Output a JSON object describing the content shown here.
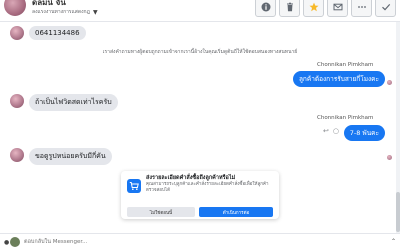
{
  "header": {
    "contact_name": "ดลมนี จัน",
    "status": "ลงแรงงานทางการแสดงกฎ",
    "toolbar": [
      {
        "icon": "info-icon"
      },
      {
        "icon": "trash-icon"
      },
      {
        "icon": "star-icon"
      },
      {
        "icon": "mail-icon"
      },
      {
        "icon": "more-icon"
      },
      {
        "icon": "check-icon"
      }
    ]
  },
  "messages": {
    "m1": "0641134486",
    "system_note": "เราส่งคำถามทางผู้ตอบถูกถามเข้าจากเรานี้อ้างในคุณเริ่มดูต้นถี่ให้ใช้ตอบสนองทางสนทนาย์",
    "sender1": "Chonnikan Pimkham",
    "out1": "ลูกค้าต้องการรับสายกี่โมงคะ",
    "in2": "ถ้าเป็นไฟวิดสดเท่าไรครับ",
    "sender2": "Chonnikan Pimkham",
    "out2": "7-8 พันคะ",
    "in3": "ขอดูรูปหน่อยครับมีกี่คัน"
  },
  "card": {
    "title": "ส่งรายละเอียดคำสั่งซื้อถึงลูกค้าหรือไม่",
    "description": "คุณสามารถระบุลูกค้าและคำสั่งรายละเอียดคำสั่งซื้อเพื่อให้ลูกค้าตรวจสอบได้",
    "decline_label": "ไม่ใช่ตอนนี้",
    "accept_label": "ดำเนินการต่อ"
  },
  "composer": {
    "placeholder": "ตอบกลับใน Messenger..."
  },
  "colors": {
    "accent": "#1877f2",
    "incoming_bubble": "#e4e6eb"
  }
}
